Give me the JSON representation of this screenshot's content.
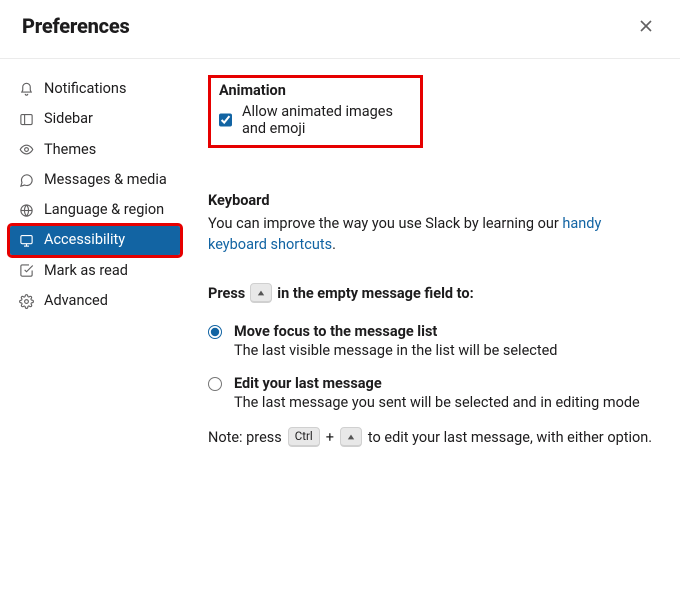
{
  "header": {
    "title": "Preferences"
  },
  "sidebar": {
    "items": [
      {
        "label": "Notifications"
      },
      {
        "label": "Sidebar"
      },
      {
        "label": "Themes"
      },
      {
        "label": "Messages & media"
      },
      {
        "label": "Language & region"
      },
      {
        "label": "Accessibility"
      },
      {
        "label": "Mark as read"
      },
      {
        "label": "Advanced"
      }
    ]
  },
  "content": {
    "animation": {
      "heading": "Animation",
      "checkbox_label": "Allow animated images and emoji",
      "checked": true
    },
    "keyboard": {
      "heading": "Keyboard",
      "desc_pre": "You can improve the way you use Slack by learning our ",
      "link_text": "handy keyboard shortcuts",
      "desc_post": ".",
      "press_pre": "Press",
      "press_post": "in the empty message field to:",
      "options": [
        {
          "title": "Move focus to the message list",
          "sub": "The last visible message in the list will be selected",
          "selected": true
        },
        {
          "title": "Edit your last message",
          "sub": "The last message you sent will be selected and in editing mode",
          "selected": false
        }
      ],
      "note_pre": "Note: press",
      "ctrl_key": "Ctrl",
      "plus": "+",
      "note_post": "to edit your last message, with either option."
    }
  }
}
